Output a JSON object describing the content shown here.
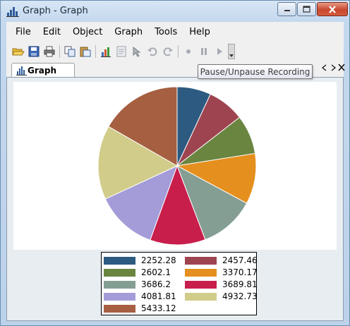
{
  "window": {
    "title": "Graph - Graph"
  },
  "menu": {
    "items": [
      "File",
      "Edit",
      "Object",
      "Graph",
      "Tools",
      "Help"
    ]
  },
  "toolbar": {
    "icons": [
      "open-folder-icon",
      "save-icon",
      "print-icon",
      "copy-icon",
      "paste-icon",
      "chart-icon",
      "properties-icon",
      "pointer-icon",
      "undo-icon",
      "redo-icon",
      "record-icon",
      "pause-icon",
      "play-icon"
    ],
    "tooltip": "Pause/Unpause Recording"
  },
  "tabs": {
    "active_label": "Graph"
  },
  "chart_data": {
    "type": "pie",
    "title": "",
    "start_angle_deg": 0,
    "direction": "clockwise",
    "legend_position": "bottom",
    "slices": [
      {
        "value": 2252.28,
        "color": "#2d5a80"
      },
      {
        "value": 2457.46,
        "color": "#9e4450"
      },
      {
        "value": 2602.1,
        "color": "#6a8540"
      },
      {
        "value": 3370.17,
        "color": "#e58f1e"
      },
      {
        "value": 3686.2,
        "color": "#859e93"
      },
      {
        "value": 3689.81,
        "color": "#c81e4c"
      },
      {
        "value": 4081.81,
        "color": "#a39cd8"
      },
      {
        "value": 4932.73,
        "color": "#d1cc8a"
      },
      {
        "value": 5433.12,
        "color": "#a65f41"
      }
    ]
  }
}
